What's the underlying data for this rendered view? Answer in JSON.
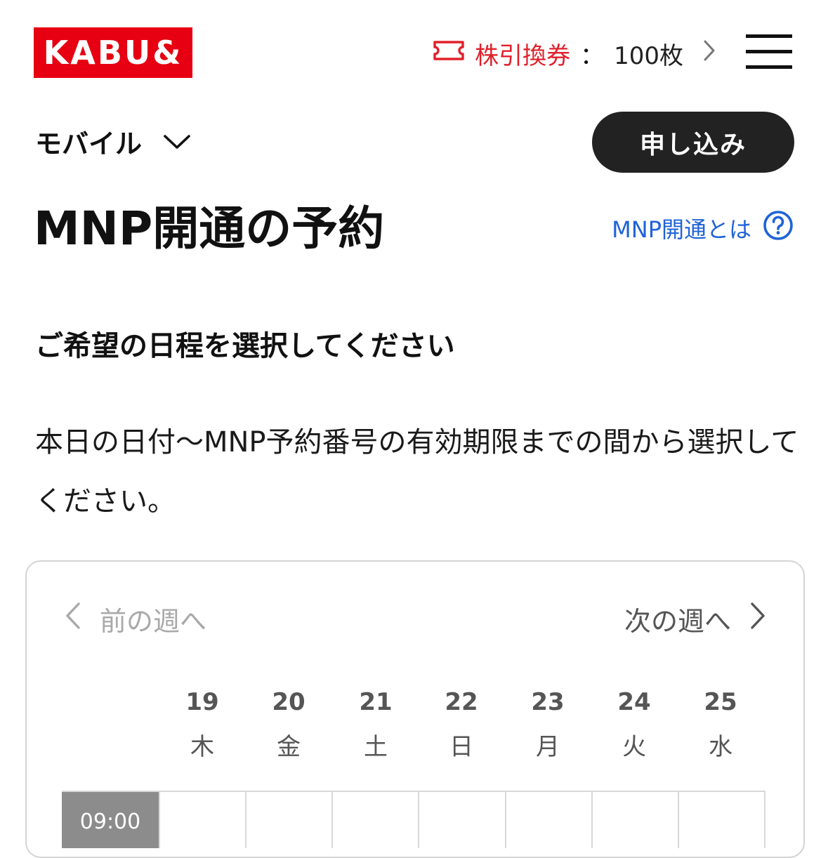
{
  "header": {
    "logo_text": "KABU&",
    "ticket_label": "株引換券",
    "ticket_separator": "：",
    "ticket_count": "100枚"
  },
  "category": {
    "label": "モバイル"
  },
  "apply_button": {
    "label": "申し込み"
  },
  "page_title": "MNP開通の予約",
  "help_link": {
    "label": "MNP開通とは",
    "icon": "question-circle-icon"
  },
  "section_heading": "ご希望の日程を選択してください",
  "description": "本日の日付〜MNP予約番号の有効期限までの間から選択してください。",
  "calendar": {
    "prev_week_label": "前の週へ",
    "next_week_label": "次の週へ",
    "days": [
      {
        "date": "19",
        "weekday": "木"
      },
      {
        "date": "20",
        "weekday": "金"
      },
      {
        "date": "21",
        "weekday": "土"
      },
      {
        "date": "22",
        "weekday": "日"
      },
      {
        "date": "23",
        "weekday": "月"
      },
      {
        "date": "24",
        "weekday": "火"
      },
      {
        "date": "25",
        "weekday": "水"
      }
    ],
    "time_slots": [
      "09:00"
    ]
  },
  "colors": {
    "brand_red": "#e60012",
    "link_blue": "#1f63d8",
    "button_dark": "#222222"
  }
}
